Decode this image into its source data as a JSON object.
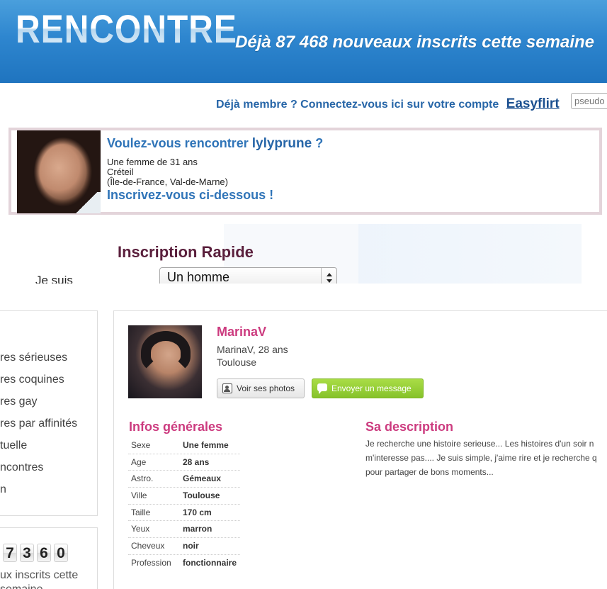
{
  "top": {
    "logo": "RENCONTRE",
    "tagline": "Déjà 87 468 nouveaux inscrits cette semaine",
    "member_prompt": "Déjà membre ? Connectez-vous ici sur votre compte",
    "member_link": "Easyflirt",
    "pseudo_placeholder": "pseudo",
    "profile": {
      "question_prefix": "Voulez-vous rencontrer ",
      "name": "lylyprune",
      "question_suffix": " ?",
      "line1": "Une femme de 31 ans",
      "line2": "Créteil",
      "line3": "(Île-de-France, Val-de-Marne)",
      "cta": "Inscrivez-vous ci-dessous !"
    },
    "form": {
      "title": "Inscription Rapide",
      "je_suis_label": "Je suis",
      "je_suis_value": "Un homme"
    }
  },
  "bottom": {
    "left_links": [
      "res sérieuses",
      "res coquines",
      "res gay",
      "res par affinités",
      "tuelle",
      "ncontres",
      "n"
    ],
    "counter_digits": [
      "7",
      "3",
      "6",
      "0"
    ],
    "counter_line1": "ux inscrits cette",
    "counter_line2": "semaine",
    "member": {
      "name": "MarinaV",
      "line1": "MarinaV, 28 ans",
      "line2": "Toulouse",
      "btn_photos": "Voir ses photos",
      "btn_message": "Envoyer un message"
    },
    "infos_title": "Infos générales",
    "infos": [
      {
        "key": "Sexe",
        "value": "Une femme"
      },
      {
        "key": "Age",
        "value": "28 ans"
      },
      {
        "key": "Astro.",
        "value": "Gémeaux"
      },
      {
        "key": "Ville",
        "value": "Toulouse"
      },
      {
        "key": "Taille",
        "value": "170 cm"
      },
      {
        "key": "Yeux",
        "value": "marron"
      },
      {
        "key": "Cheveux",
        "value": "noir"
      },
      {
        "key": "Profession",
        "value": "fonctionnaire"
      }
    ],
    "description_title": "Sa description",
    "description_lines": [
      "Je recherche une histoire serieuse... Les histoires d'un soir n",
      "m'interesse pas.... Je suis simple, j'aime rire et je recherche q",
      "pour partager de bons moments..."
    ]
  }
}
